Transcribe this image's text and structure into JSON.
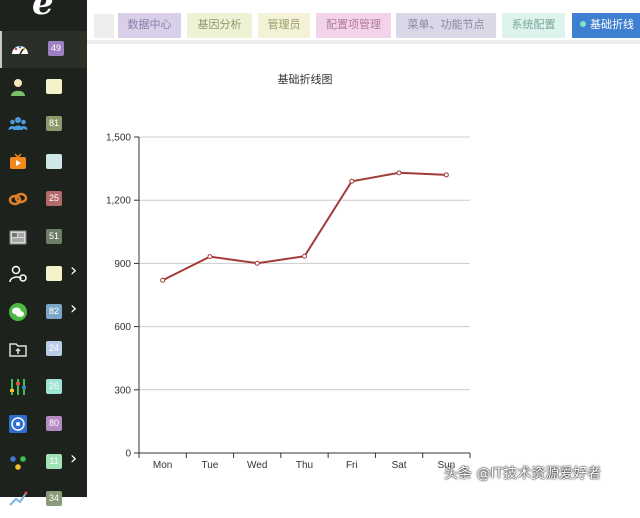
{
  "sidebar": {
    "logo": "e",
    "items": [
      {
        "icon": "dashboard-icon",
        "badge": "49",
        "badge_color": "#9e7fc4",
        "arrow": false
      },
      {
        "icon": "user-icon",
        "badge": "",
        "badge_color": "#f3f2c8",
        "arrow": false
      },
      {
        "icon": "users-group-icon",
        "badge": "81",
        "badge_color": "#8d9a6b",
        "arrow": false
      },
      {
        "icon": "tv-icon",
        "badge": "",
        "badge_color": "#cfe6e6",
        "arrow": false
      },
      {
        "icon": "link-icon",
        "badge": "25",
        "badge_color": "#b46a6a",
        "arrow": false
      },
      {
        "icon": "newspaper-icon",
        "badge": "51",
        "badge_color": "#6f7f66",
        "arrow": false
      },
      {
        "icon": "user-settings-icon",
        "badge": "",
        "badge_color": "#f3f2c8",
        "arrow": true
      },
      {
        "icon": "wechat-icon",
        "badge": "82",
        "badge_color": "#7aa7c7",
        "arrow": true
      },
      {
        "icon": "folder-upload-icon",
        "badge": "24",
        "badge_color": "#b9cde8",
        "arrow": false
      },
      {
        "icon": "sliders-icon",
        "badge": "26",
        "badge_color": "#9fe3d5",
        "arrow": false
      },
      {
        "icon": "disc-icon",
        "badge": "80",
        "badge_color": "#b58ac2",
        "arrow": false
      },
      {
        "icon": "share-nodes-icon",
        "badge": "11",
        "badge_color": "#9fe3b5",
        "arrow": true
      },
      {
        "icon": "chart-icon",
        "badge": "34",
        "badge_color": "#8a9a7a",
        "arrow": false
      }
    ]
  },
  "tabs": [
    {
      "label": "数据中心",
      "bg": "#d9cfe8",
      "color": "#8a7fa8",
      "active": false
    },
    {
      "label": "基因分析",
      "bg": "#eef3d6",
      "color": "#8a9a6a",
      "active": false
    },
    {
      "label": "管理员",
      "bg": "#f3f2d6",
      "color": "#9a9a6a",
      "active": false
    },
    {
      "label": "配置项管理",
      "bg": "#f2d3ea",
      "color": "#b07aa0",
      "active": false
    },
    {
      "label": "菜单、功能节点",
      "bg": "#dcd7e6",
      "color": "#8a86a0",
      "active": false
    },
    {
      "label": "系统配置",
      "bg": "#dff3ee",
      "color": "#7aa69a",
      "active": false
    },
    {
      "label": "基础折线",
      "bg": "#3f7fd1",
      "color": "#ffffff",
      "active": true
    }
  ],
  "chart_data": {
    "type": "line",
    "title": "基础折线图",
    "categories": [
      "Mon",
      "Tue",
      "Wed",
      "Thu",
      "Fri",
      "Sat",
      "Sun"
    ],
    "series": [
      {
        "values": [
          820,
          932,
          901,
          934,
          1290,
          1330,
          1320
        ]
      }
    ],
    "ylim": [
      0,
      1500
    ],
    "yticks": [
      "0",
      "300",
      "600",
      "900",
      "1,200",
      "1,500"
    ],
    "line_color": "#a23b35",
    "grid": true,
    "legend": "none"
  },
  "watermark": "头条 @IT技术资源爱好者"
}
